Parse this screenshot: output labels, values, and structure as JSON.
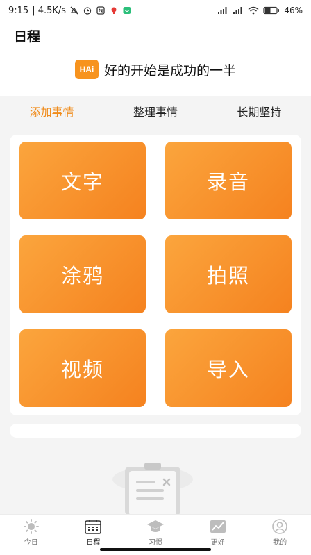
{
  "status_bar": {
    "time": "9:15",
    "network": "| 4.5K/s",
    "battery": "46%",
    "icons": [
      "mute-icon",
      "alarm-icon",
      "nfc-icon",
      "location-icon",
      "app-icon",
      "signal-icon",
      "signal-icon",
      "wifi-icon",
      "battery-icon"
    ]
  },
  "header": {
    "title": "日程",
    "logo_text": "HAi",
    "motto": "好的开始是成功的一半"
  },
  "tabs": [
    {
      "label": "添加事情",
      "active": true
    },
    {
      "label": "整理事情",
      "active": false
    },
    {
      "label": "长期坚持",
      "active": false
    }
  ],
  "actions": {
    "text": "文字",
    "record": "录音",
    "doodle": "涂鸦",
    "photo": "拍照",
    "video": "视频",
    "import": "导入"
  },
  "bottom_nav": [
    {
      "label": "今日",
      "icon": "sun-icon",
      "active": false
    },
    {
      "label": "日程",
      "icon": "calendar-icon",
      "active": true
    },
    {
      "label": "习惯",
      "icon": "graduation-cap-icon",
      "active": false
    },
    {
      "label": "更好",
      "icon": "trend-chart-icon",
      "active": false
    },
    {
      "label": "我的",
      "icon": "profile-icon",
      "active": false
    }
  ],
  "colors": {
    "accent": "#f08c1c",
    "tile_gradient_start": "#fba53d",
    "tile_gradient_end": "#f5821f",
    "background": "#f4f4f4"
  }
}
